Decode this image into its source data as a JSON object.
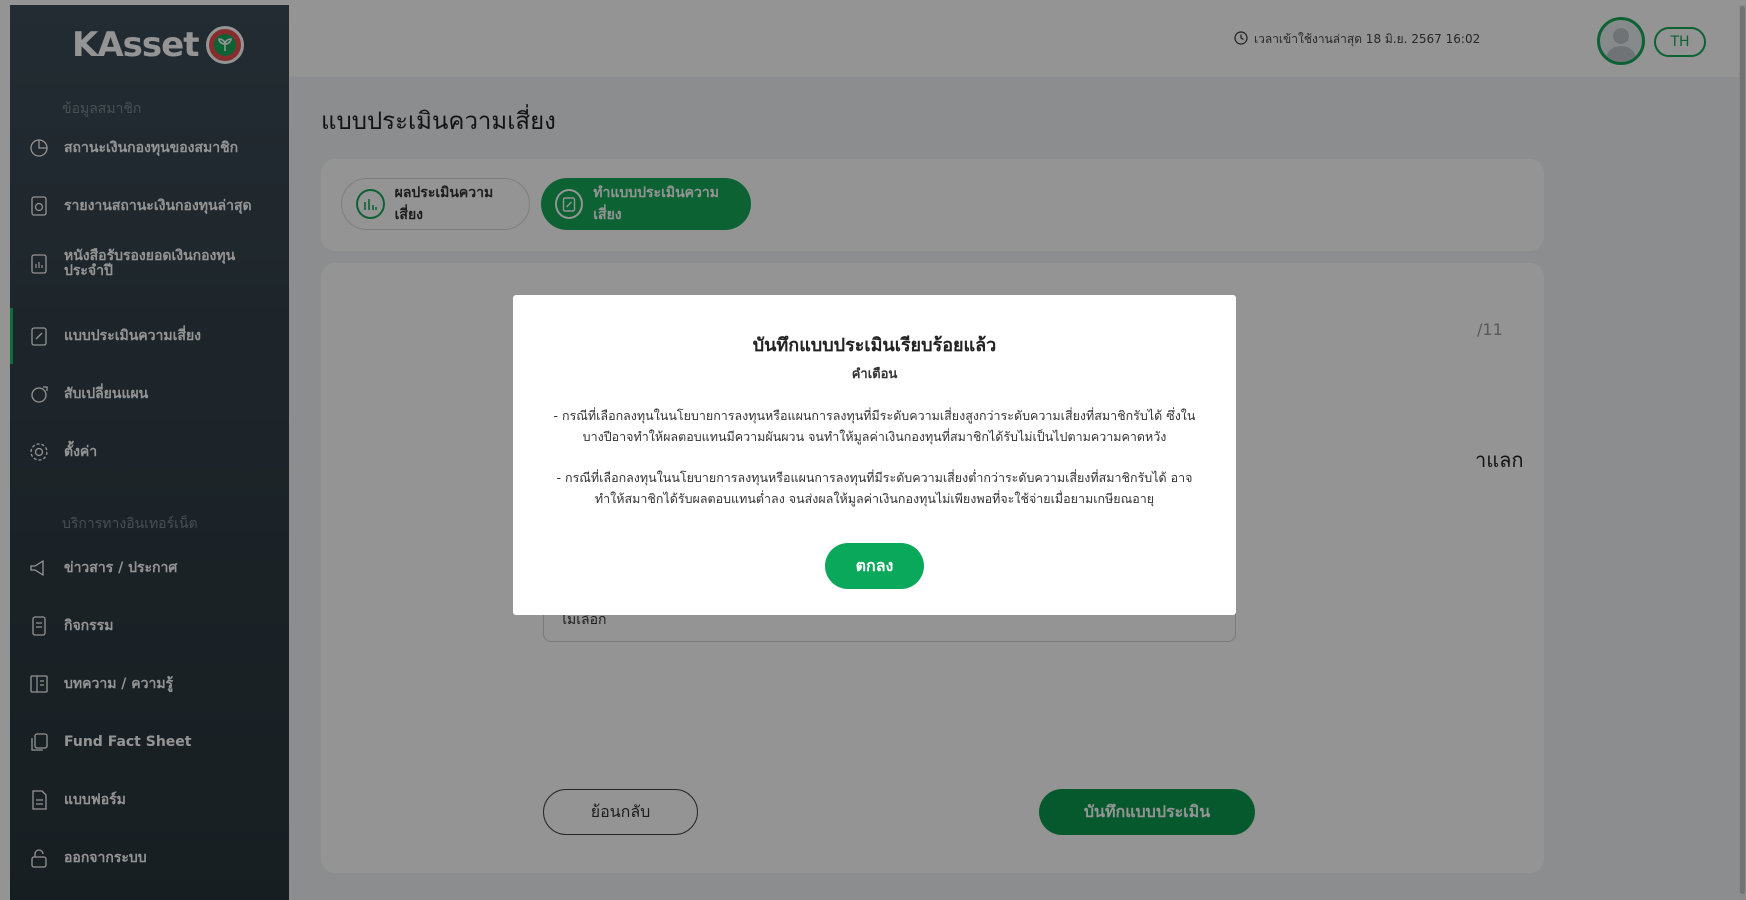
{
  "app": {
    "logo_text": "KAsset"
  },
  "header": {
    "last_login": "เวลาเข้าใช้งานล่าสุด 18 มิ.ย. 2567 16:02",
    "lang_label": "TH"
  },
  "sidebar": {
    "section_member": "ข้อมูลสมาชิก",
    "section_internet": "บริการทางอินเทอร์เน็ต",
    "items": [
      {
        "label": "สถานะเงินกองทุนของสมาชิก",
        "icon": "pie-chart-icon"
      },
      {
        "label": "รายงานสถานะเงินกองทุนล่าสุด",
        "icon": "report-icon"
      },
      {
        "label": "หนังสือรับรองยอดเงินกองทุนประจำปี",
        "icon": "certificate-icon"
      },
      {
        "label": "แบบประเมินความเสี่ยง",
        "icon": "assessment-icon"
      },
      {
        "label": "สับเปลี่ยนแผน",
        "icon": "switch-plan-icon"
      },
      {
        "label": "ตั้งค่า",
        "icon": "gear-icon"
      },
      {
        "label": "ข่าวสาร / ประกาศ",
        "icon": "megaphone-icon"
      },
      {
        "label": "กิจกรรม",
        "icon": "activity-icon"
      },
      {
        "label": "บทความ / ความรู้",
        "icon": "article-icon"
      },
      {
        "label": "Fund Fact Sheet",
        "icon": "copy-icon"
      },
      {
        "label": "แบบฟอร์ม",
        "icon": "form-icon"
      },
      {
        "label": "ออกจากระบบ",
        "icon": "lock-icon"
      }
    ],
    "active_index": 3
  },
  "main": {
    "title": "แบบประเมินความเสี่ยง",
    "tabs": [
      {
        "label": "ผลประเมินความเสี่ยง"
      },
      {
        "label": "ทำแบบประเมินความเสี่ยง"
      }
    ],
    "page_counter_partial": "/11",
    "question_partial": "าแลก",
    "options": [
      "",
      "ไม่เลือก"
    ],
    "back_label": "ย้อนกลับ",
    "save_label": "บันทึกแบบประเมิน"
  },
  "modal": {
    "title": "บันทึกแบบประเมินเรียบร้อยแล้ว",
    "subtitle": "คำเตือน",
    "para1_line1": "- กรณีที่เลือกลงทุนในนโยบายการลงทุนหรือแผนการลงทุนที่มีระดับความเสี่ยงสูงกว่าระดับความเสี่ยงที่สมาชิกรับได้ ซึ่งใน",
    "para1_line2": "บางปีอาจทำให้ผลตอบแทนมีความผันผวน จนทำให้มูลค่าเงินกองทุนที่สมาชิกได้รับไม่เป็นไปตามความคาดหวัง",
    "para2_line1": "- กรณีที่เลือกลงทุนในนโยบายการลงทุนหรือแผนการลงทุนที่มีระดับความเสี่ยงต่ำกว่าระดับความเสี่ยงที่สมาชิกรับได้ อาจ",
    "para2_line2": "ทำให้สมาชิกได้รับผลตอบแทนต่ำลง จนส่งผลให้มูลค่าเงินกองทุนไม่เพียงพอที่จะใช้จ่ายเมื่อยามเกษียณอายุ",
    "ok_label": "ตกลง"
  },
  "colors": {
    "brand_green": "#18a95a",
    "sidebar_bg": "#2f3c44"
  }
}
